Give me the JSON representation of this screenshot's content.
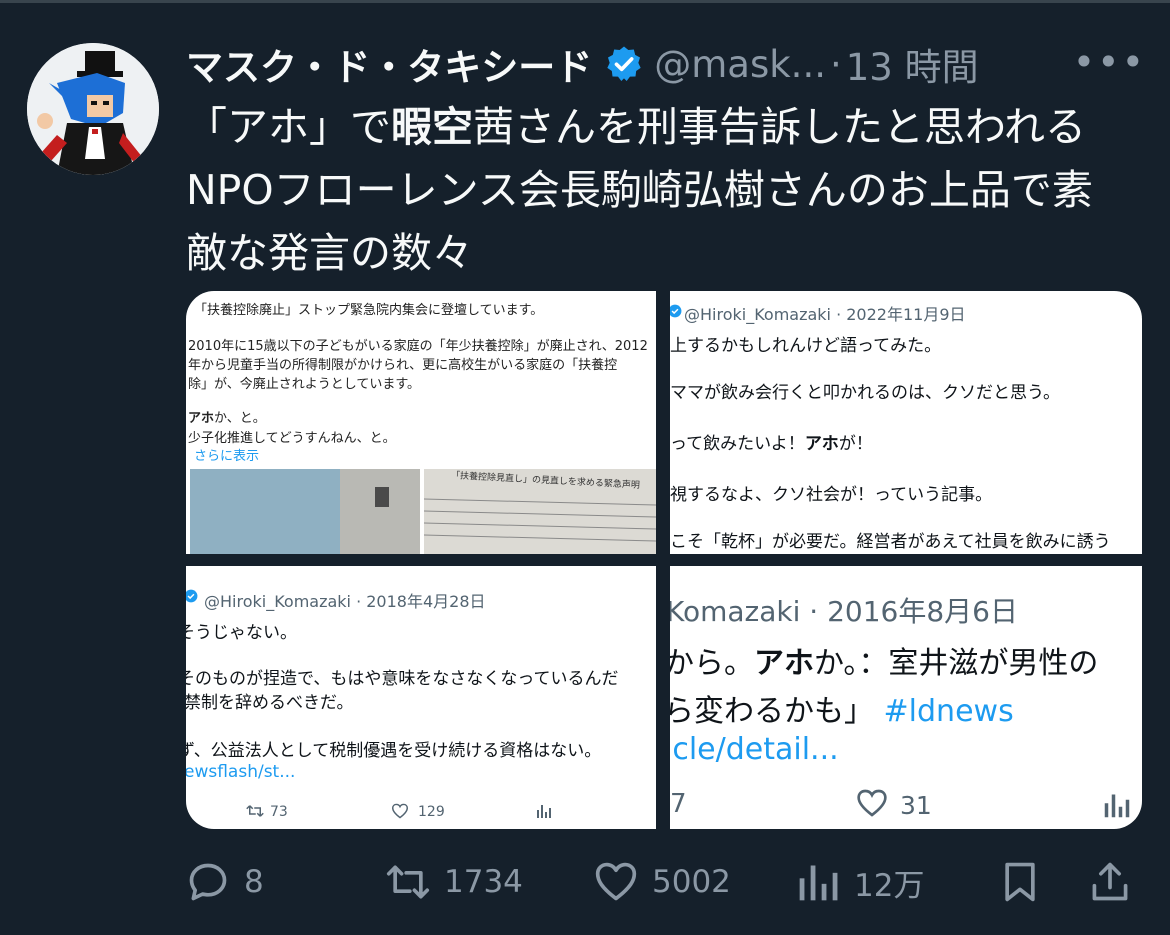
{
  "tweet": {
    "display_name": "マスク・ド・タキシード",
    "handle": "@mask...",
    "separator": "·",
    "time": "13 時間",
    "more": "•••",
    "text_line1_a": "「アホ」で",
    "text_line1_bold": "暇空",
    "text_line1_b": "茜さんを刑事告訴したと思われる",
    "text_line2": "NPOフローレンス会長駒崎弘樹さんのお上品で素",
    "text_line3": "敵な発言の数々"
  },
  "media": {
    "img1": {
      "line1": "「扶養控除廃止」ストップ緊急院内集会に登壇しています。",
      "line2": "2010年に15歳以下の子どもがいる家庭の「年少扶養控除」が廃止され、2012",
      "line3": "年から児童手当の所得制限がかけられ、更に高校生がいる家庭の「扶養控",
      "line4": "除」が、今廃止されようとしています。",
      "line5_bold": "アホ",
      "line5_rest": "か、と。",
      "line6": "少子化推進してどうすんねん、と。",
      "more": "さらに表示",
      "poster_text": "「扶養控除見直し」の見直しを求める緊急声明"
    },
    "img2": {
      "meta": "@Hiroki_Komazaki · 2022年11月9日",
      "line1": "上するかもしれんけど語ってみた。",
      "line2": "ママが飲み会行くと叩かれるのは、クソだと思う。",
      "line3_a": "って飲みたいよ！",
      "line3_bold": "アホ",
      "line3_b": "が！",
      "line4": "視するなよ、クソ社会が！っていう記事。",
      "line5": "こそ「乾杯」が必要だ。経営者があえて社員を飲みに誘う"
    },
    "img3": {
      "meta": "@Hiroki_Komazaki · 2018年4月28日",
      "line1": "そうじゃない。",
      "line2": "そのものが捏造で、もはや意味をなさなくなっているんだ",
      "line3": "禁制を辞めるべきだ。",
      "line4": "ず、公益法人として税制優遇を受け続ける資格はない。",
      "link": "ewsflash/st...",
      "retweets": "73",
      "likes": "129"
    },
    "img4": {
      "meta": "Komazaki · 2016年8月6日",
      "line1_a": "から。",
      "line1_bold": "アホ",
      "line1_b": "か。：室井滋が男性の",
      "line2": "ら変わるかも」",
      "hashtag": "#ldnews",
      "link": "icle/detail...",
      "left_num": "7",
      "likes": "31"
    }
  },
  "actions": {
    "replies": "8",
    "retweets": "1734",
    "likes": "5002",
    "views": "12万"
  },
  "colors": {
    "background": "#15202b",
    "text": "#f7f9f9",
    "muted": "#8b98a5",
    "accent": "#1d9bf0"
  }
}
